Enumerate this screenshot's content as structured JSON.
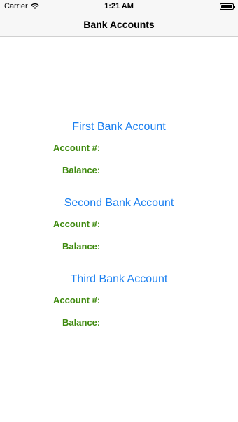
{
  "status_bar": {
    "carrier": "Carrier",
    "time": "1:21 AM",
    "wifi_icon": "wifi-icon",
    "battery_icon": "battery-icon"
  },
  "nav": {
    "title": "Bank Accounts"
  },
  "accounts": [
    {
      "title": "First Bank Account",
      "account_label": "Account #:",
      "balance_label": "Balance:"
    },
    {
      "title": "Second Bank Account",
      "account_label": "Account #:",
      "balance_label": "Balance:"
    },
    {
      "title": "Third Bank Account",
      "account_label": "Account #:",
      "balance_label": "Balance:"
    }
  ],
  "colors": {
    "title_blue": "#1a7ff0",
    "label_green": "#3f8a0f",
    "bar_bg": "#f7f7f7"
  }
}
